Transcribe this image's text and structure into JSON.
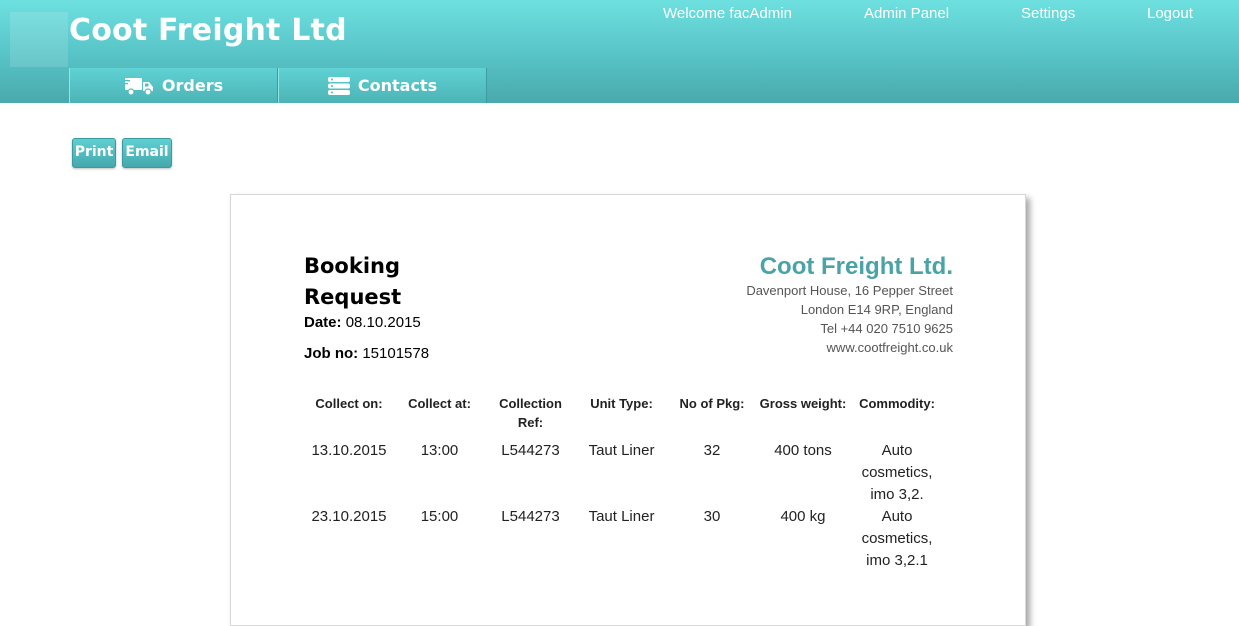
{
  "header": {
    "brand": "Coot Freight Ltd",
    "nav": {
      "welcome": "Welcome facAdmin",
      "admin": "Admin Panel",
      "settings": "Settings",
      "logout": "Logout"
    },
    "tabs": [
      {
        "label": "Orders",
        "icon": "truck-icon"
      },
      {
        "label": "Contacts",
        "icon": "server-stack-icon"
      }
    ]
  },
  "actions": {
    "print": "Print",
    "email": "Email"
  },
  "document": {
    "title_line1": "Booking",
    "title_line2": "Request",
    "date_label": "Date:",
    "date_value": "08.10.2015",
    "job_label": "Job no:",
    "job_value": "15101578",
    "company": {
      "name": "Coot Freight Ltd.",
      "address1": "Davenport House, 16 Pepper Street",
      "address2": "London E14 9RP, England",
      "tel": "Tel +44 020 7510 9625",
      "web": "www.cootfreight.co.uk"
    },
    "table": {
      "columns": [
        "Collect on:",
        "Collect at:",
        "Collection Ref:",
        "Unit Type:",
        "No of Pkg:",
        "Gross weight:",
        "Commodity:"
      ],
      "rows": [
        [
          "13.10.2015",
          "13:00",
          "L544273",
          "Taut Liner",
          "32",
          "400 tons",
          "Auto cosmetics, imo 3,2."
        ],
        [
          "23.10.2015",
          "15:00",
          "L544273",
          "Taut Liner",
          "30",
          "400 kg",
          "Auto cosmetics, imo 3,2.1"
        ]
      ]
    }
  },
  "colors": {
    "header_top": "#6ee0e0",
    "header_bottom": "#49a9ac",
    "company_name": "#4aa3a6"
  }
}
